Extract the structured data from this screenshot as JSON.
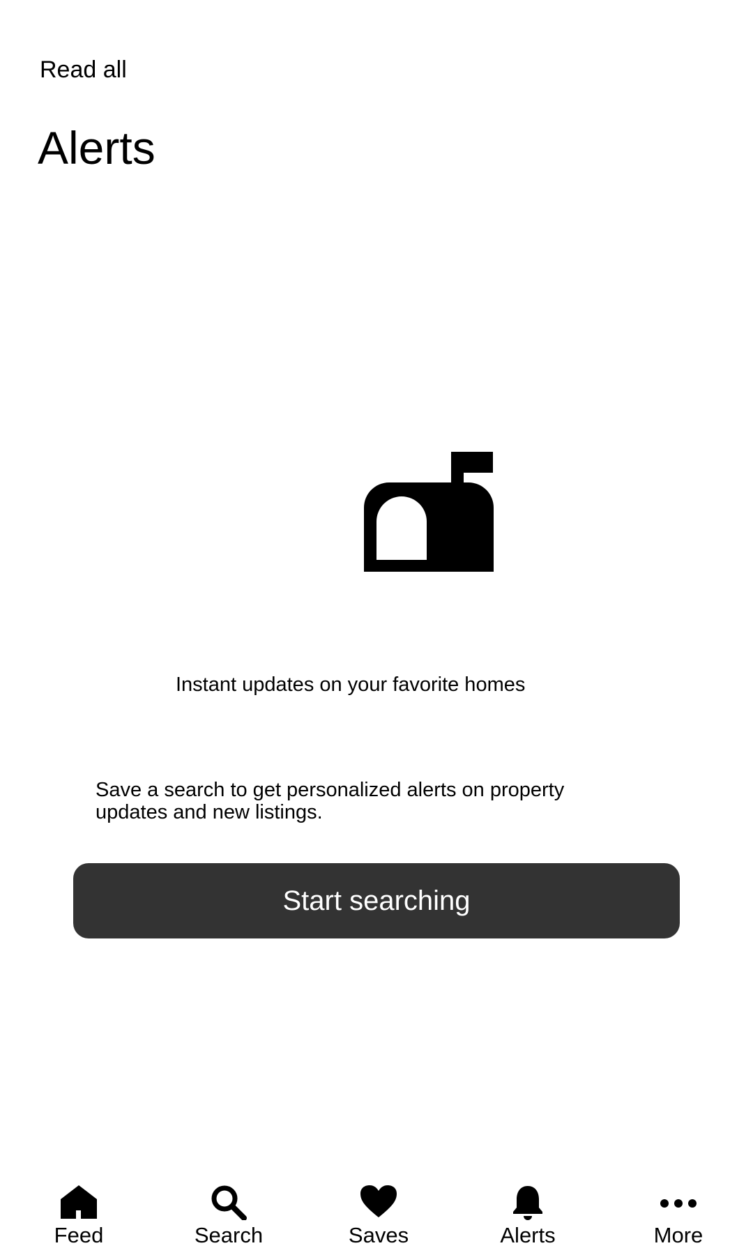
{
  "header": {
    "read_all_label": "Read all",
    "title": "Alerts"
  },
  "empty_state": {
    "icon": "mailbox-icon",
    "headline": "Instant updates on your favorite homes",
    "description": "Save a search to get personalized alerts on property updates and new listings.",
    "button_label": "Start searching"
  },
  "colors": {
    "button_bg": "#333333",
    "button_text": "#ffffff",
    "text": "#000000",
    "background": "#ffffff"
  },
  "tabbar": {
    "items": [
      {
        "label": "Feed",
        "icon": "home-icon"
      },
      {
        "label": "Search",
        "icon": "search-icon"
      },
      {
        "label": "Saves",
        "icon": "heart-icon"
      },
      {
        "label": "Alerts",
        "icon": "bell-icon"
      },
      {
        "label": "More",
        "icon": "more-icon"
      }
    ]
  }
}
